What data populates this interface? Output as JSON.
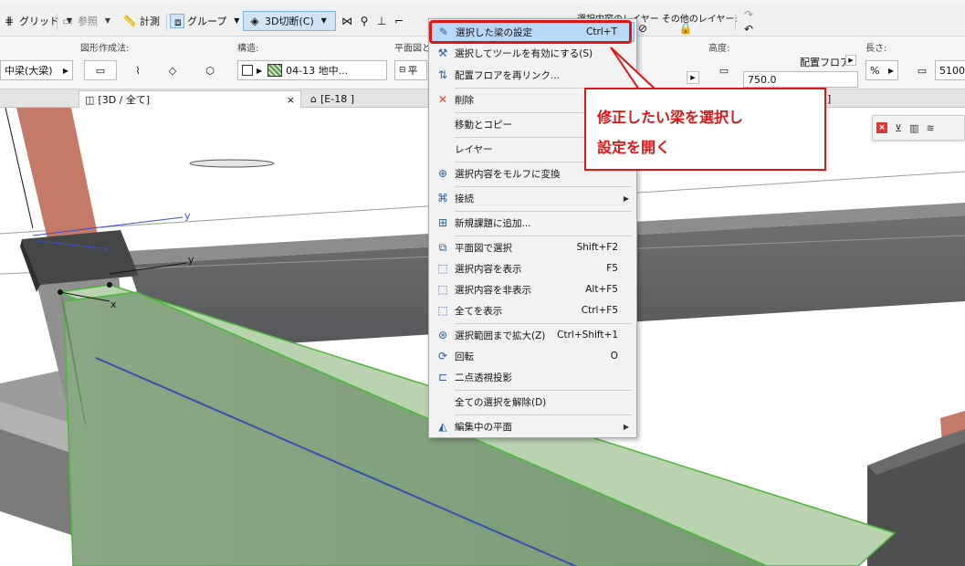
{
  "colors": {
    "accent_red": "#e01414",
    "highlight_blue": "#b9d8f5",
    "selection_green": "#6abf5a",
    "brick": "#c47a66",
    "concrete_dark": "#5a5c5c",
    "concrete_mid": "#8b8c8a"
  },
  "toolbar": {
    "grid_label": "グリッド",
    "reference_label": "参照",
    "measure_label": "計測",
    "group_label": "グループ",
    "cut3d_label": "3D切断(C)",
    "other_layers_label": "その他のレイヤー:",
    "selection_layer_label": "選択内容のレイヤー"
  },
  "infobox": {
    "geometry_label": "図形作成法:",
    "structure_label": "構造:",
    "plan_label": "平面図と",
    "height_label": "高度:",
    "length_label": "長さ:",
    "type_value": "中梁(大梁)",
    "material_value": "04-13 地中...",
    "plan_value": "平",
    "floor_label": "配置フロア",
    "height_value": "750.0",
    "length_value": "5100.",
    "percent_value": "%"
  },
  "tabs": {
    "view3d": "[3D / 全て]",
    "elevation": "[E-18 ]",
    "close_symbol": "×",
    "right_fragment": "]"
  },
  "viewport": {
    "axis_y1": "y",
    "axis_y2": "y",
    "axis_x1": "x",
    "axis_x2": "x"
  },
  "context_menu": {
    "items": [
      {
        "icon": "beam-settings-icon",
        "glyph": "✎",
        "label": "選択した梁の設定",
        "shortcut": "Ctrl+T"
      },
      {
        "icon": "tool-icon",
        "glyph": "⚒",
        "label": "選択してツールを有効にする(S)",
        "shortcut": ""
      },
      {
        "icon": "relink-icon",
        "glyph": "⇅",
        "label": "配置フロアを再リンク...",
        "shortcut": ""
      },
      {
        "icon": "delete-icon",
        "glyph": "✕",
        "label": "削除",
        "shortcut": ""
      },
      {
        "icon": "",
        "glyph": "",
        "label": "移動とコピー",
        "shortcut": ""
      },
      {
        "icon": "",
        "glyph": "",
        "label": "レイヤー",
        "shortcut": ""
      },
      {
        "icon": "morph-icon",
        "glyph": "⊕",
        "label": "選択内容をモルフに変換",
        "shortcut": ""
      },
      {
        "icon": "connect-icon",
        "glyph": "⌘",
        "label": "接続",
        "shortcut": ""
      },
      {
        "icon": "new-issue-icon",
        "glyph": "⊞",
        "label": "新規課題に追加...",
        "shortcut": ""
      },
      {
        "icon": "select-in-plan-icon",
        "glyph": "⧉",
        "label": "平面図で選択",
        "shortcut": "Shift+F2"
      },
      {
        "icon": "show-selection-icon",
        "glyph": "⬚",
        "label": "選択内容を表示",
        "shortcut": "F5"
      },
      {
        "icon": "hide-selection-icon",
        "glyph": "⬚",
        "label": "選択内容を非表示",
        "shortcut": "Alt+F5"
      },
      {
        "icon": "show-all-icon",
        "glyph": "⬚",
        "label": "全てを表示",
        "shortcut": "Ctrl+F5"
      },
      {
        "icon": "zoom-selection-icon",
        "glyph": "⊛",
        "label": "選択範囲まで拡大(Z)",
        "shortcut": "Ctrl+Shift+1"
      },
      {
        "icon": "orbit-icon",
        "glyph": "⟳",
        "label": "回転",
        "shortcut": "O"
      },
      {
        "icon": "two-point-perspective-icon",
        "glyph": "⊏",
        "label": "二点透視投影",
        "shortcut": ""
      },
      {
        "icon": "",
        "glyph": "",
        "label": "全ての選択を解除(D)",
        "shortcut": ""
      },
      {
        "icon": "editing-plane-icon",
        "glyph": "◭",
        "label": "編集中の平面",
        "shortcut": ""
      }
    ]
  },
  "callout": {
    "line1": "修正したい梁を選択し",
    "line2": "設定を開く"
  }
}
